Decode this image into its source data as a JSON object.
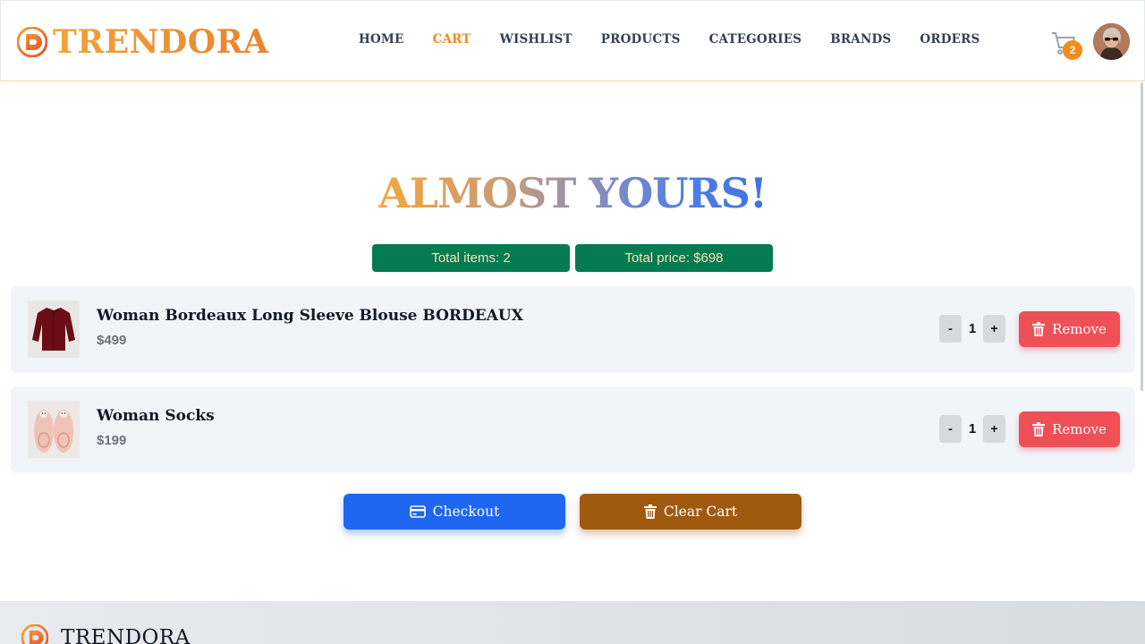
{
  "brand": {
    "name": "TRENDORA",
    "accent": "#ef8a23"
  },
  "nav": {
    "items": [
      {
        "label": "HOME"
      },
      {
        "label": "CART"
      },
      {
        "label": "WISHLIST"
      },
      {
        "label": "PRODUCTS"
      },
      {
        "label": "CATEGORIES"
      },
      {
        "label": "BRANDS"
      },
      {
        "label": "ORDERS"
      }
    ],
    "active": "CART"
  },
  "header": {
    "cart_count": "2",
    "cart_icon": "cart-icon",
    "avatar_icon": "user-avatar"
  },
  "page": {
    "title": "ALMOST YOURS!",
    "total_items": "Total items: 2",
    "total_price": "Total price: $698"
  },
  "cart": {
    "items": [
      {
        "name": "Woman Bordeaux Long Sleeve Blouse BORDEAUX",
        "price": "$499",
        "quantity": "1",
        "remove_label": "Remove"
      },
      {
        "name": "Woman Socks",
        "price": "$199",
        "quantity": "1",
        "remove_label": "Remove"
      }
    ],
    "qty_minus": "-",
    "qty_plus": "+"
  },
  "actions": {
    "checkout_label": "Checkout",
    "clear_label": "Clear Cart"
  },
  "colors": {
    "summary_pill": "#067a52",
    "remove": "#ef4f56",
    "checkout": "#1f66f0",
    "clear": "#a05a10"
  },
  "footer": {
    "brand": "TRENDORA"
  }
}
